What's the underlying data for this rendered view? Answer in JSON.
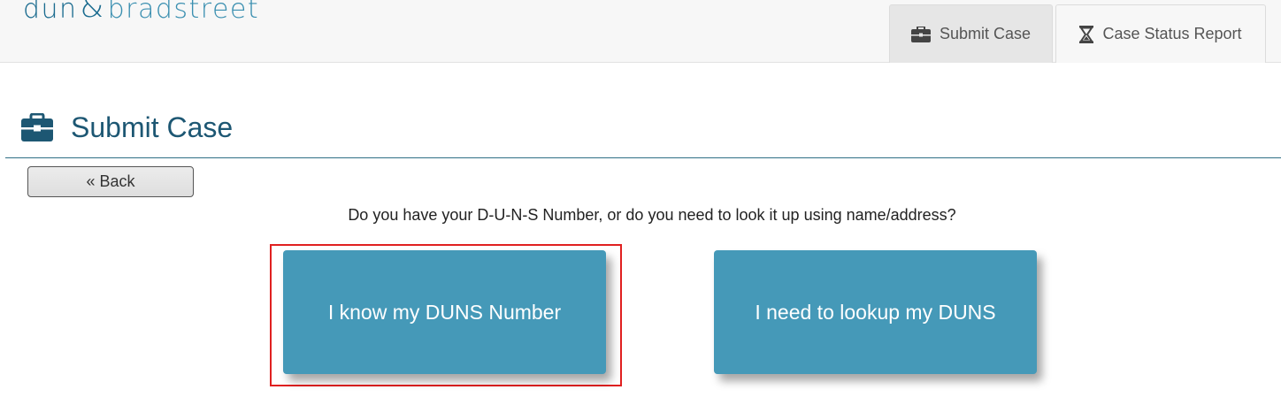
{
  "brand": {
    "logo_left": "dun",
    "logo_amp": "&",
    "logo_right": "bradstreet"
  },
  "tabs": [
    {
      "label": "Submit Case",
      "icon": "briefcase-icon",
      "active": true
    },
    {
      "label": "Case Status Report",
      "icon": "hourglass-icon",
      "active": false
    }
  ],
  "page": {
    "title": "Submit Case",
    "title_icon": "briefcase-icon"
  },
  "back_button": {
    "label": "« Back"
  },
  "question": "Do you have your D-U-N-S Number, or do you need to look it up using name/address?",
  "choices": [
    {
      "label": "I know my DUNS Number",
      "highlighted": true
    },
    {
      "label": "I need to lookup my DUNS",
      "highlighted": false
    }
  ],
  "colors": {
    "brand": "#1a6b8f",
    "button": "#4599b8",
    "highlight": "#e02020"
  }
}
